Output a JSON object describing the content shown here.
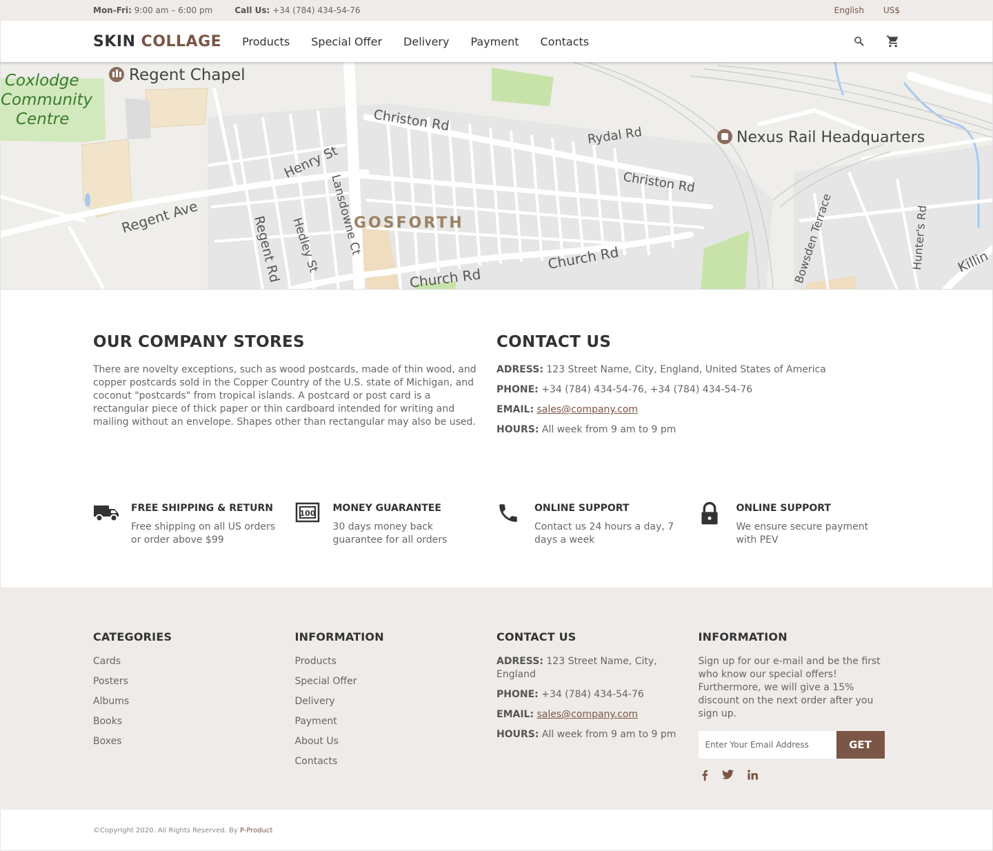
{
  "topbar": {
    "hours_label": "Mon-Fri:",
    "hours_value": "9:00 am – 6:00 pm",
    "call_label": "Call Us:",
    "call_value": "+34 (784) 434-54-76",
    "language": "English",
    "currency": "US$"
  },
  "header": {
    "logo_part1": "SKIN",
    "logo_part2": "COLLAGE",
    "nav": [
      "Products",
      "Special Offer",
      "Delivery",
      "Payment",
      "Contacts"
    ],
    "icons": [
      "search-icon",
      "cart-icon"
    ]
  },
  "map": {
    "labels": {
      "coxlodge": [
        "Coxlodge",
        "Community",
        "Centre"
      ],
      "regent_chapel": "Regent Chapel",
      "christon1": "Christon Rd",
      "rydal": "Rydal Rd",
      "nexus": "Nexus Rail Headquarters",
      "henry": "Henry St",
      "christon2": "Christon Rd",
      "lansdowne": "Lansdowne Ct",
      "regent_ave": "Regent Ave",
      "regent_rd": "Regent Rd",
      "hedley": "Hedley St",
      "gosforth": "GOSFORTH",
      "church1": "Church Rd",
      "church2": "Church Rd",
      "bowsden": "Bowsden Terrace",
      "hunters": "Hunter's Rd",
      "killing": "Killin"
    }
  },
  "stores": {
    "title": "OUR COMPANY STORES",
    "text": "There are novelty exceptions, such as wood postcards, made of thin wood, and copper postcards sold in the Copper Country of the U.S. state of Michigan, and coconut \"postcards\" from tropical islands. A postcard or post card is a rectangular piece of thick paper or thin cardboard intended for writing and mailing without an envelope. Shapes other than rectangular may also be used."
  },
  "contact": {
    "title": "CONTACT US",
    "address_label": "ADRESS:",
    "address": "123 Street Name, City, England, United States of America",
    "phone_label": "PHONE:",
    "phone": "+34 (784) 434-54-76, +34 (784) 434-54-76",
    "email_label": "EMAIL:",
    "email": "sales@company.com",
    "hours_label": "HOURS:",
    "hours": "All week from 9 am to 9 pm"
  },
  "features": [
    {
      "icon": "truck-icon",
      "title": "FREE SHIPPING & RETURN",
      "text": "Free shipping on all US orders or order above $99"
    },
    {
      "icon": "money-icon",
      "title": "MONEY GUARANTEE",
      "text": "30 days money back guarantee for all orders"
    },
    {
      "icon": "phone-icon",
      "title": "ONLINE SUPPORT",
      "text": "Contact us 24 hours a day, 7 days a week"
    },
    {
      "icon": "lock-icon",
      "title": "ONLINE SUPPORT",
      "text": "We ensure secure payment with PEV"
    }
  ],
  "footer": {
    "categories": {
      "title": "CATEGORIES",
      "items": [
        "Cards",
        "Posters",
        "Albums",
        "Books",
        "Boxes"
      ]
    },
    "information": {
      "title": "INFORMATION",
      "items": [
        "Products",
        "Special Offer",
        "Delivery",
        "Payment",
        "About Us",
        "Contacts"
      ]
    },
    "contact": {
      "title": "CONTACT US",
      "address_label": "ADRESS:",
      "address": "123 Street Name, City, England",
      "phone_label": "PHONE:",
      "phone": "+34 (784) 434-54-76",
      "email_label": "EMAIL:",
      "email": "sales@company.com",
      "hours_label": "HOURS:",
      "hours": "All week from 9 am to 9 pm"
    },
    "newsletter": {
      "title": "INFORMATION",
      "text": "Sign up for our e-mail and be the first who know our special offers! Furthermore, we will give a 15% discount on the next order after you sign up.",
      "placeholder": "Enter Your Email Address",
      "button": "GET",
      "social": [
        "facebook-icon",
        "twitter-icon",
        "linkedin-icon"
      ]
    }
  },
  "copyright": {
    "text": "©Copyright 2020. All Rights Reserved. By ",
    "link": "P-Product"
  }
}
